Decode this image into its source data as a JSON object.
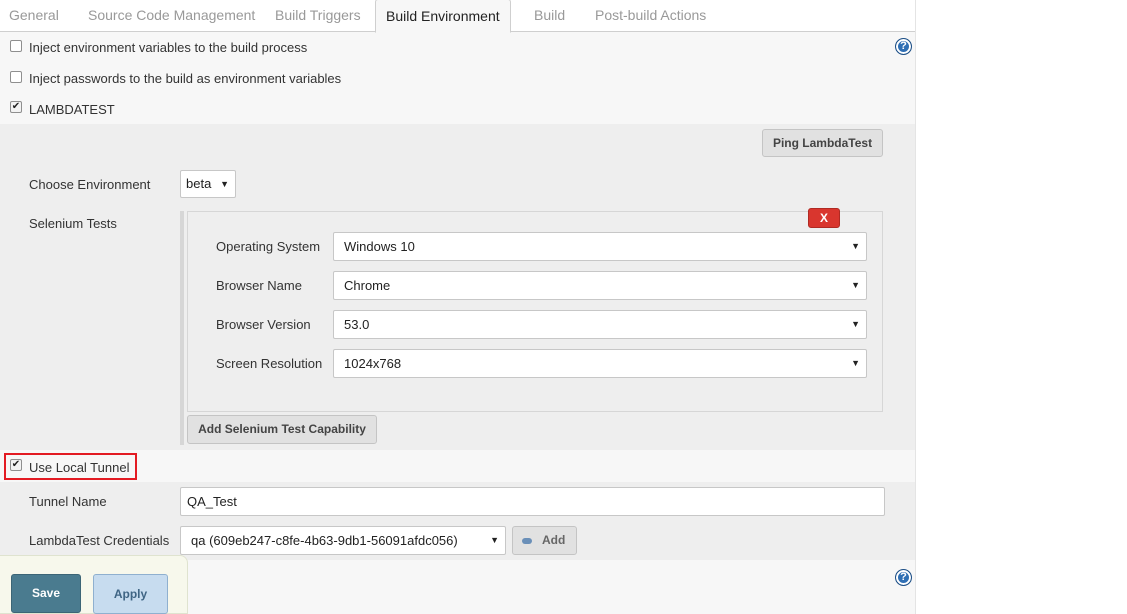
{
  "tabs": [
    {
      "label": "General",
      "active": false
    },
    {
      "label": "Source Code Management",
      "active": false
    },
    {
      "label": "Build Triggers",
      "active": false
    },
    {
      "label": "Build Environment",
      "active": true
    },
    {
      "label": "Build",
      "active": false
    },
    {
      "label": "Post-build Actions",
      "active": false
    }
  ],
  "options": {
    "inject_env": {
      "label": "Inject environment variables to the build process",
      "checked": false
    },
    "inject_passwords": {
      "label": "Inject passwords to the build as environment variables",
      "checked": false
    },
    "lambdatest": {
      "label": "LAMBDATEST",
      "checked": true
    }
  },
  "lambdatest": {
    "ping_button": "Ping LambdaTest",
    "environment": {
      "label": "Choose Environment",
      "value": "beta"
    },
    "selenium": {
      "label": "Selenium Tests",
      "delete_button": "X",
      "fields": {
        "os": {
          "label": "Operating System",
          "value": "Windows 10"
        },
        "browser": {
          "label": "Browser Name",
          "value": "Chrome"
        },
        "version": {
          "label": "Browser Version",
          "value": "53.0"
        },
        "resolution": {
          "label": "Screen Resolution",
          "value": "1024x768"
        }
      },
      "add_button": "Add Selenium Test Capability"
    },
    "local_tunnel": {
      "label": "Use Local Tunnel",
      "checked": true
    },
    "tunnel_name": {
      "label": "Tunnel Name",
      "value": "QA_Test"
    },
    "credentials": {
      "label": "LambdaTest Credentials",
      "value": "qa (609eb247-c8fe-4b63-9db1-56091afdc056)",
      "add_button": "Add"
    }
  },
  "help_icon_glyph": "?",
  "dropdown_glyph": "▼",
  "check_glyph": "✔",
  "footer": {
    "save": "Save",
    "apply": "Apply"
  },
  "colors": {
    "accent_delete": "#d9362e",
    "highlight": "#e31b23",
    "save": "#4a7b8f",
    "apply": "#c7dcef"
  }
}
